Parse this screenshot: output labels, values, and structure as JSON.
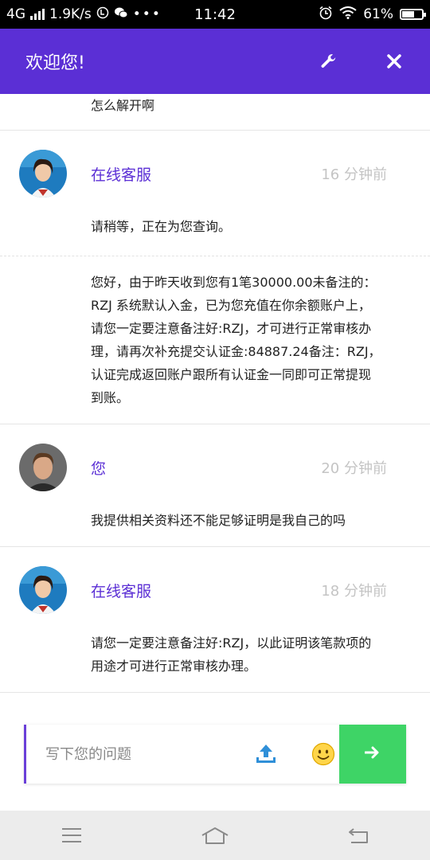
{
  "status_bar": {
    "network": "4G",
    "speed": "1.9K/s",
    "time": "11:42",
    "battery_percent": "61%",
    "battery_level": 0.61
  },
  "header": {
    "title": "欢迎您!",
    "color": "#5b2fd5"
  },
  "messages": {
    "top_snippet": "怎么解开啊",
    "items": [
      {
        "sender": "在线客服",
        "time": "16 分钟前",
        "paragraphs": [
          "请稍等，正在为您查询。",
          "您好，由于昨天收到您有1笔30000.00未备注的：RZJ 系统默认入金，已为您充值在你余额账户上，请您一定要注意备注好:RZJ，才可进行正常审核办理，请再次补充提交认证金:84887.24备注：RZJ，认证完成返回账户跟所有认证金一同即可正常提现到账。"
        ]
      },
      {
        "sender": "您",
        "time": "20 分钟前",
        "paragraphs": [
          "我提供相关资料还不能足够证明是我自己的吗"
        ]
      },
      {
        "sender": "在线客服",
        "time": "18 分钟前",
        "paragraphs": [
          "请您一定要注意备注好:RZJ，以此证明该笔款项的用途才可进行正常审核办理。"
        ]
      }
    ]
  },
  "composer": {
    "placeholder": "写下您的问题",
    "upload_icon": "upload-icon",
    "emoji_icon": "smiley-icon",
    "send_icon": "arrow-right-icon",
    "send_color": "#3ed466"
  },
  "nav": {
    "icons": [
      "menu-icon",
      "home-icon",
      "back-icon"
    ]
  }
}
